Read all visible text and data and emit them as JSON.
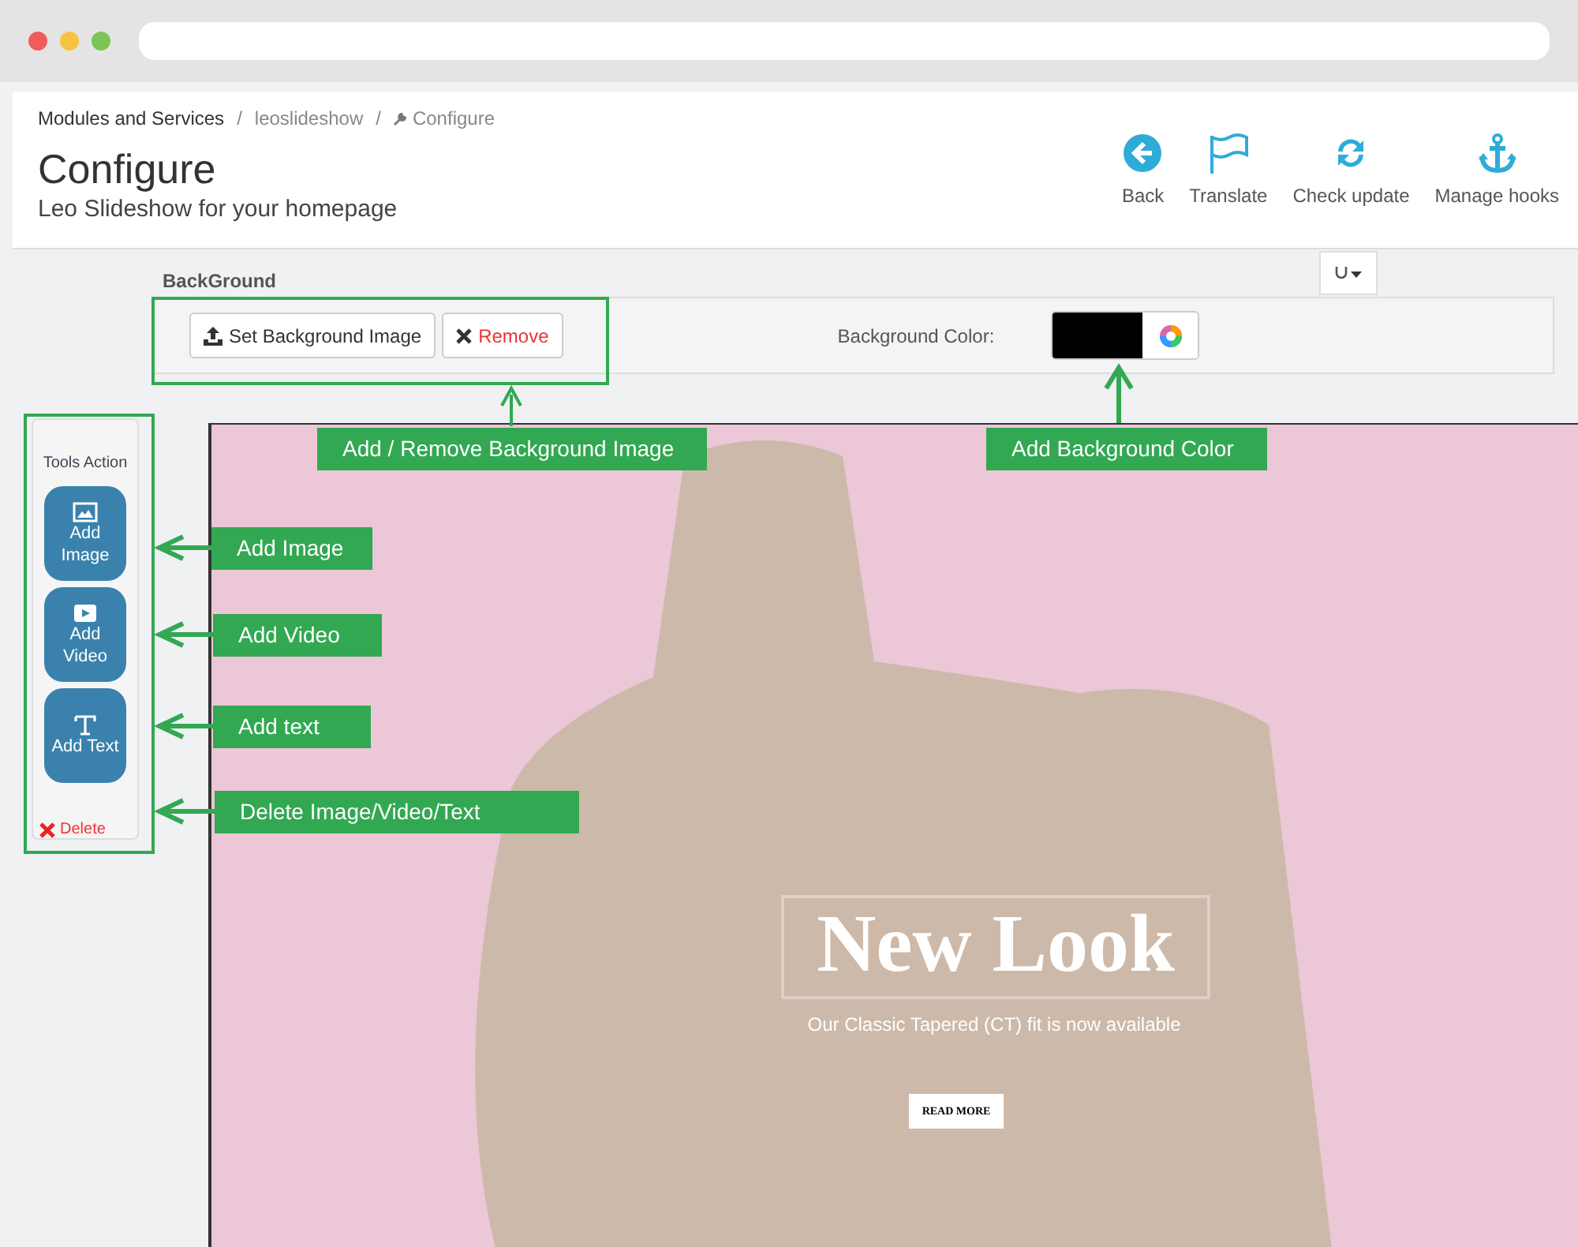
{
  "breadcrumb": [
    {
      "label": "Modules and Services",
      "kind": "link"
    },
    {
      "label": "/",
      "kind": "separator"
    },
    {
      "label": "leoslideshow",
      "kind": "link"
    },
    {
      "label": "/",
      "kind": "separator"
    },
    {
      "label": "Configure",
      "kind": "current"
    }
  ],
  "header": {
    "title": "Configure",
    "subtitle": "Leo Slideshow for your homepage"
  },
  "toolbar": [
    {
      "label": "Back",
      "kind": "back"
    },
    {
      "label": "Translate",
      "kind": "translate"
    },
    {
      "label": "Check update",
      "kind": "update"
    },
    {
      "label": "Manage hooks",
      "kind": "hooks"
    }
  ],
  "background": {
    "heading": "BackGround",
    "set_image": "Set Background Image",
    "remove": "Remove",
    "color_label": "Background Color:"
  },
  "tools": {
    "title": "Tools Action",
    "items": [
      {
        "label": "Add Image",
        "kind": "image"
      },
      {
        "label": "Add Video",
        "kind": "video"
      },
      {
        "label": "Add Text",
        "kind": "text"
      }
    ],
    "delete": "Delete"
  },
  "slide": {
    "heading": "New Look",
    "caption": "Our Classic Tapered (CT) fit is now available",
    "button": "READ MORE"
  },
  "annotations": [
    {
      "label": "Add / Remove Background Image",
      "kind": "up"
    },
    {
      "label": "Add Background Color",
      "kind": "up"
    },
    {
      "label": "Add Image",
      "kind": "left"
    },
    {
      "label": "Add Video",
      "kind": "left"
    },
    {
      "label": "Add text",
      "kind": "left"
    },
    {
      "label": "Delete Image/Video/Text",
      "kind": "left"
    }
  ]
}
